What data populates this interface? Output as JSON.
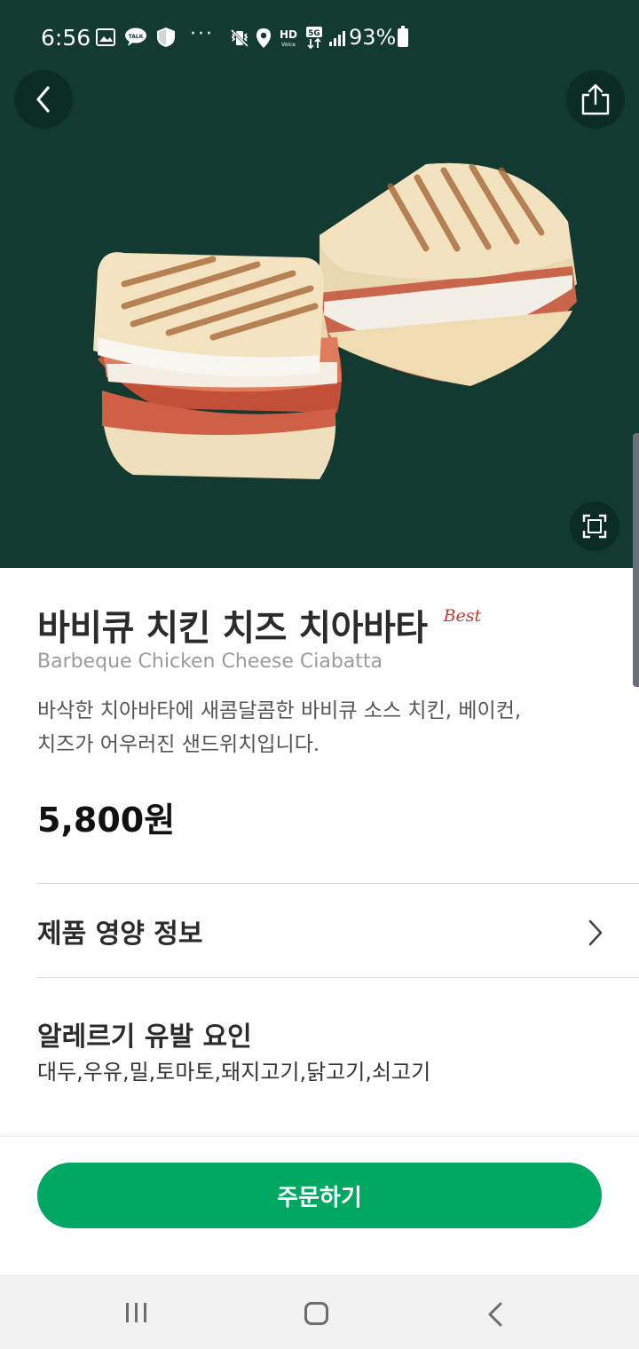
{
  "status_bar": {
    "time": "6:56",
    "dots": "···",
    "battery": "93%",
    "hd_label": "HD",
    "net_label": "5G"
  },
  "product": {
    "name_ko": "바비큐 치킨 치즈 치아바타",
    "badge": "Best",
    "name_en": "Barbeque Chicken Cheese Ciabatta",
    "description_line1": "바삭한 치아바타에 새콤달콤한 바비큐 소스 치킨, 베이컨,",
    "description_line2": "치즈가 어우러진 샌드위치입니다.",
    "price": "5,800원"
  },
  "nutrition": {
    "label": "제품 영양 정보"
  },
  "allergy": {
    "title": "알레르기 유발 요인",
    "list": "대두,우유,밀,토마토,돼지고기,닭고기,쇠고기"
  },
  "order": {
    "button_label": "주문하기"
  },
  "colors": {
    "hero_bg": "#123a30",
    "order_green": "#00a862",
    "best_red": "#c0392b"
  },
  "icons": {
    "back": "chevron-left-icon",
    "share": "share-icon",
    "expand": "expand-icon",
    "nutrition_arrow": "chevron-right-icon"
  }
}
